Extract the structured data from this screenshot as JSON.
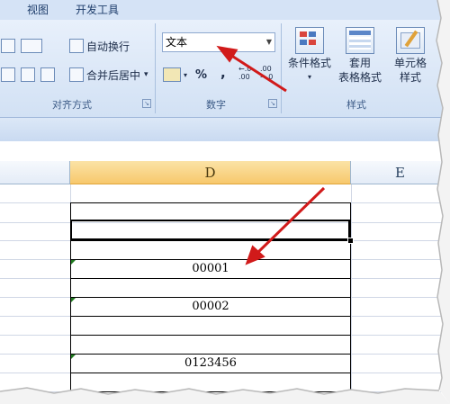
{
  "ribbon": {
    "tabs": [
      "视图",
      "开发工具"
    ],
    "alignment": {
      "wrap_text": "自动换行",
      "merge_center": "合并后居中",
      "merge_arrow": "▾",
      "group_label": "对齐方式"
    },
    "number": {
      "format_value": "文本",
      "percent": "%",
      "comma": ",",
      "increase_decimal": "←.0\n.00",
      "decrease_decimal": ".00\n→.0",
      "group_label": "数字"
    },
    "styles": {
      "conditional_format": "条件格式",
      "format_as_table_1": "套用",
      "format_as_table_2": "表格格式",
      "cell_styles_1": "单元格",
      "cell_styles_2": "样式",
      "group_label": "样式"
    }
  },
  "sheet": {
    "columns": [
      "D",
      "E"
    ],
    "selected_column": "D",
    "cells": [
      "00001",
      "00002",
      "0123456"
    ]
  },
  "colors": {
    "accent_arrow": "#d11a1a",
    "error_triangle": "#1f7a1f",
    "selected_header": "#f7c86c"
  }
}
